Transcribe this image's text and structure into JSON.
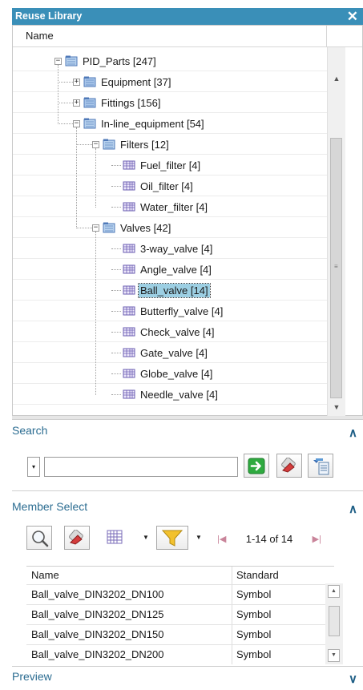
{
  "window": {
    "title": "Reuse Library",
    "close_glyph": "✕"
  },
  "tree": {
    "header": "Name",
    "nodes": [
      {
        "label": "PID_Parts [247]",
        "level": 0,
        "expander": "−",
        "icon": "folder-open-icon"
      },
      {
        "label": "Equipment [37]",
        "level": 1,
        "expander": "+",
        "icon": "folder-icon"
      },
      {
        "label": "Fittings [156]",
        "level": 1,
        "expander": "+",
        "icon": "folder-icon"
      },
      {
        "label": "In-line_equipment [54]",
        "level": 1,
        "expander": "−",
        "icon": "folder-open-icon"
      },
      {
        "label": "Filters [12]",
        "level": 2,
        "expander": "−",
        "icon": "folder-open-icon"
      },
      {
        "label": "Fuel_filter [4]",
        "level": 3,
        "expander": "",
        "icon": "part-icon"
      },
      {
        "label": "Oil_filter [4]",
        "level": 3,
        "expander": "",
        "icon": "part-icon"
      },
      {
        "label": "Water_filter [4]",
        "level": 3,
        "expander": "",
        "icon": "part-icon"
      },
      {
        "label": "Valves [42]",
        "level": 2,
        "expander": "−",
        "icon": "folder-open-icon"
      },
      {
        "label": "3-way_valve [4]",
        "level": 3,
        "expander": "",
        "icon": "part-icon"
      },
      {
        "label": "Angle_valve [4]",
        "level": 3,
        "expander": "",
        "icon": "part-icon"
      },
      {
        "label": "Ball_valve [14]",
        "level": 3,
        "expander": "",
        "icon": "part-icon",
        "selected": true
      },
      {
        "label": "Butterfly_valve [4]",
        "level": 3,
        "expander": "",
        "icon": "part-icon"
      },
      {
        "label": "Check_valve [4]",
        "level": 3,
        "expander": "",
        "icon": "part-icon"
      },
      {
        "label": "Gate_valve [4]",
        "level": 3,
        "expander": "",
        "icon": "part-icon"
      },
      {
        "label": "Globe_valve [4]",
        "level": 3,
        "expander": "",
        "icon": "part-icon"
      },
      {
        "label": "Needle_valve [4]",
        "level": 3,
        "expander": "",
        "icon": "part-icon"
      }
    ]
  },
  "search": {
    "title": "Search",
    "collapse_glyph": "^",
    "input_value": "",
    "dropdown_glyph": "▾",
    "buttons": [
      "go-arrow-icon",
      "eraser-icon",
      "search-options-icon"
    ]
  },
  "member_select": {
    "title": "Member Select",
    "collapse_glyph": "^",
    "paging": "1-14 of 14",
    "prev_glyph": "|◀",
    "next_glyph": "▶|",
    "columns": [
      "Name",
      "Standard"
    ],
    "rows": [
      {
        "name": "Ball_valve_DIN3202_DN100",
        "standard": "Symbol"
      },
      {
        "name": "Ball_valve_DIN3202_DN125",
        "standard": "Symbol"
      },
      {
        "name": "Ball_valve_DIN3202_DN150",
        "standard": "Symbol"
      },
      {
        "name": "Ball_valve_DIN3202_DN200",
        "standard": "Symbol"
      }
    ]
  },
  "preview": {
    "title": "Preview",
    "expand_glyph": "v"
  },
  "colors": {
    "accent": "#3a8fb8",
    "section": "#2b6c91",
    "selection": "#9ccfe3"
  }
}
